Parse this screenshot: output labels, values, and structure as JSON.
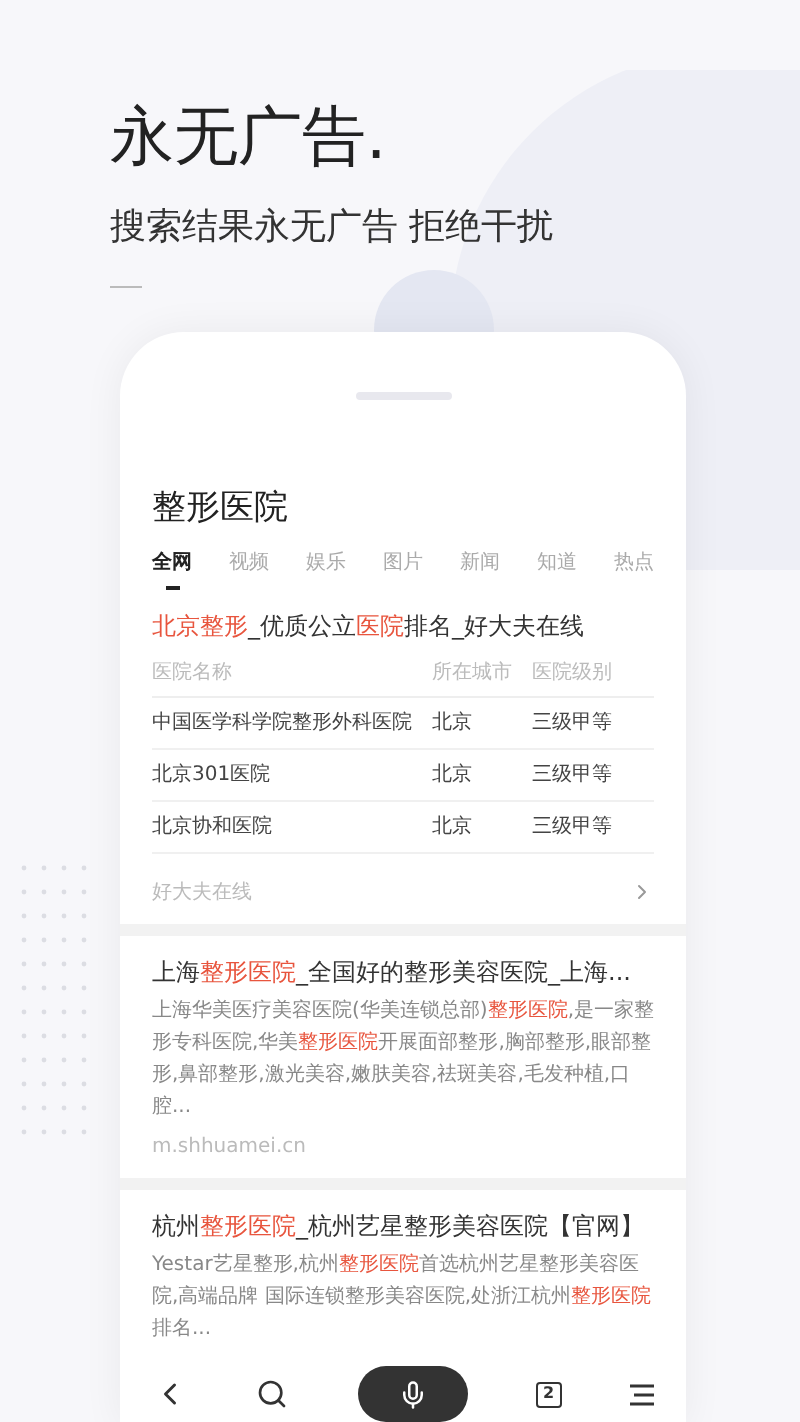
{
  "headline": "永无广告.",
  "subtitle": "搜索结果永无广告 拒绝干扰",
  "search": {
    "query": "整形医院"
  },
  "tabs": [
    {
      "label": "全网",
      "selected": true
    },
    {
      "label": "视频",
      "selected": false
    },
    {
      "label": "娱乐",
      "selected": false
    },
    {
      "label": "图片",
      "selected": false
    },
    {
      "label": "新闻",
      "selected": false
    },
    {
      "label": "知道",
      "selected": false
    },
    {
      "label": "热点",
      "selected": false
    }
  ],
  "results": [
    {
      "kind": "table",
      "title": [
        {
          "text": "北京整形",
          "highlight": true
        },
        {
          "text": "_优质公立",
          "highlight": false
        },
        {
          "text": "医院",
          "highlight": true
        },
        {
          "text": "排名_好大夫在线",
          "highlight": false
        }
      ],
      "columns": [
        "医院名称",
        "所在城市",
        "医院级别"
      ],
      "rows": [
        [
          "中国医学科学院整形外科医院",
          "北京",
          "三级甲等"
        ],
        [
          "北京301医院",
          "北京",
          "三级甲等"
        ],
        [
          "北京协和医院",
          "北京",
          "三级甲等"
        ]
      ],
      "source": "好大夫在线"
    },
    {
      "kind": "snippet",
      "title": [
        {
          "text": "上海",
          "highlight": false
        },
        {
          "text": "整形医院",
          "highlight": true
        },
        {
          "text": "_全国好的整形美容医院_上海...",
          "highlight": false
        }
      ],
      "snippet": [
        {
          "text": "上海华美医疗美容医院(华美连锁总部)",
          "highlight": false
        },
        {
          "text": "整形医院",
          "highlight": true
        },
        {
          "text": ",是一家整形专科医院,华美",
          "highlight": false
        },
        {
          "text": "整形医院",
          "highlight": true
        },
        {
          "text": "开展面部整形,胸部整形,眼部整形,鼻部整形,激光美容,嫩肤美容,祛斑美容,毛发种植,口腔...",
          "highlight": false
        }
      ],
      "url": "m.shhuamei.cn"
    },
    {
      "kind": "snippet",
      "title": [
        {
          "text": "杭州",
          "highlight": false
        },
        {
          "text": "整形医院",
          "highlight": true
        },
        {
          "text": "_杭州艺星整形美容医院【官网】",
          "highlight": false
        }
      ],
      "snippet": [
        {
          "text": "Yestar艺星整形,杭州",
          "highlight": false
        },
        {
          "text": "整形医院",
          "highlight": true
        },
        {
          "text": "首选杭州艺星整形美容医院,高端品牌 国际连锁整形美容医院,处浙江杭州",
          "highlight": false
        },
        {
          "text": "整形医院",
          "highlight": true
        },
        {
          "text": "排名...",
          "highlight": false
        }
      ]
    }
  ],
  "toolbar": {
    "tab_count": "2"
  }
}
